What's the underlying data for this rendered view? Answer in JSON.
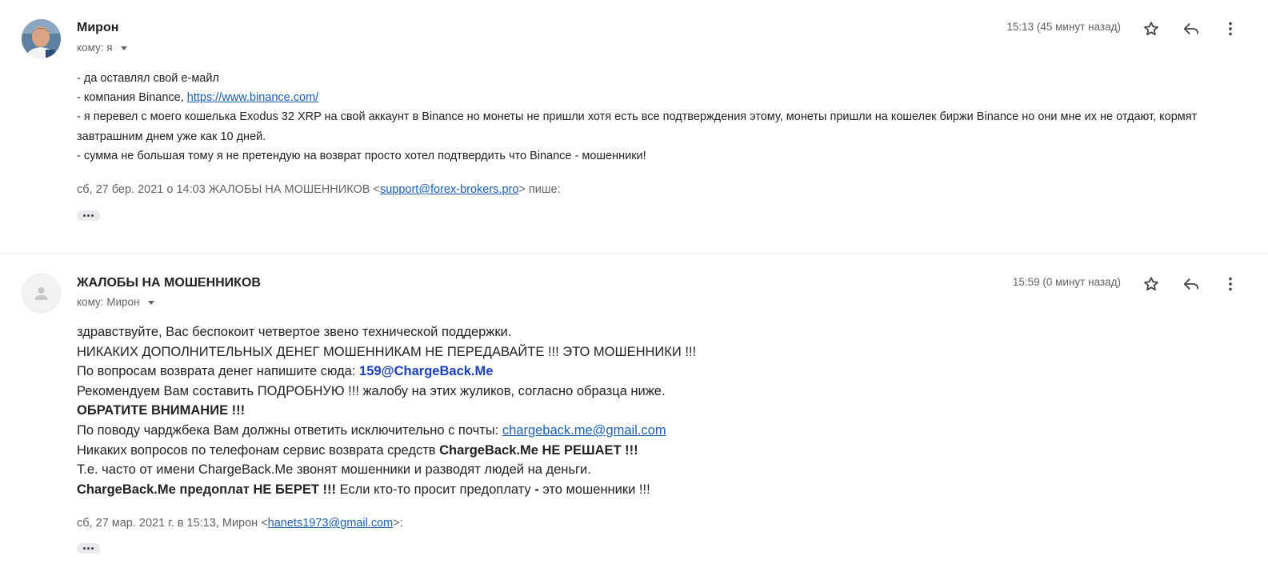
{
  "messages": [
    {
      "sender": "Мирон",
      "recipient": "кому: я",
      "time": "15:13 (45 минут назад)",
      "body": {
        "line1": "- да оставлял свой е-майл",
        "line2_prefix": "- компания Binance, ",
        "line2_link": "https://www.binance.com/",
        "line3": "- я перевел с моего кошелька Exodus 32 XRP на свой аккаунт в Binance но монеты не пришли хотя есть все подтверждения этому, монеты пришли на кошелек   биржи Binance но они мне их не отдают, кормят завтрашним днем уже как 10 дней.",
        "line4": "- сумма не большая тому я не претендую на возврат просто хотел подтвердить что Binance - мошенники!"
      },
      "quote": {
        "prefix": "сб, 27 бер. 2021 о 14:03 ЖАЛОБЫ НА МОШЕННИКОВ <",
        "email": "support@forex-brokers.pro",
        "suffix": "> пише:"
      }
    },
    {
      "sender": "ЖАЛОБЫ НА МОШЕННИКОВ",
      "recipient": "кому: Мирон",
      "time": "15:59 (0 минут назад)",
      "body": {
        "line1": "здравствуйте, Вас беспокоит четвертое звено технической поддержки.",
        "line2": "НИКАКИХ ДОПОЛНИТЕЛЬНЫХ ДЕНЕГ МОШЕННИКАМ НЕ ПЕРЕДАВАЙТЕ !!! ЭТО МОШЕННИКИ !!!",
        "line3_prefix": "По вопросам возврата денег напишите сюда: ",
        "line3_email": "159@ChargeBack.Me",
        "line4": "Рекомендуем Вам составить ПОДРОБНУЮ !!! жалобу на этих жуликов, согласно образца ниже.",
        "line5": "ОБРАТИТЕ ВНИМАНИЕ !!!",
        "line6_prefix": "По поводу чарджбека Вам должны ответить исключительно с почты: ",
        "line6_email": "chargeback.me@gmail.com",
        "line7_prefix": "Никаких вопросов по телефонам сервис возврата средств ",
        "line7_bold": "ChargeBack.Me НЕ РЕШАЕТ !!!",
        "line8": "Т.е. часто от имени ChargeBack.Me звонят мошенники и разводят людей на деньги.",
        "line9_bold": "ChargeBack.Me предоплат НЕ БЕРЕТ !!!",
        "line9_mid": " Если кто-то просит предоплату ",
        "line9_dash": "-",
        "line9_end": " это мошенники !!!"
      },
      "quote": {
        "prefix": "сб, 27 мар. 2021 г. в 15:13, Мирон <",
        "email": "hanets1973@gmail.com",
        "suffix": ">:"
      }
    }
  ],
  "icons": {
    "star": "star-icon",
    "reply": "reply-icon",
    "more": "more-vert-icon",
    "expand": "more-horiz-icon"
  },
  "colors": {
    "link": "#1a5fb4",
    "meta_text": "#5f6368",
    "email_highlight": "#1a3fbf"
  }
}
